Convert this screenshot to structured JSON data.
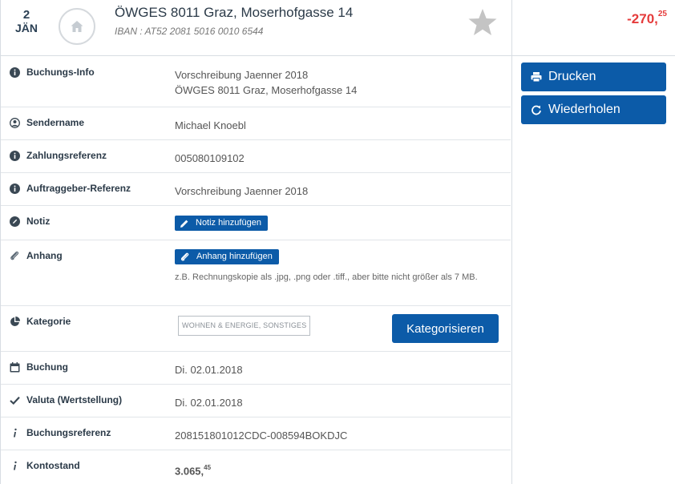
{
  "header": {
    "date_day": "2",
    "date_month": "JÄN",
    "title": "ÖWGES 8011 Graz, Moserhofgasse 14",
    "iban": "IBAN : AT52 2081 5016 0010 6544",
    "amount_main": "-270,",
    "amount_cents": "25",
    "colors": {
      "amount": "#e53b3b",
      "title": "#2b3a48"
    }
  },
  "rows": {
    "buchungsinfo": {
      "label": "Buchungs-Info",
      "line1": "Vorschreibung Jaenner 2018",
      "line2": "ÖWGES 8011 Graz, Moserhofgasse 14"
    },
    "sendername": {
      "label": "Sendername",
      "value": "Michael Knoebl"
    },
    "zahlungsreferenz": {
      "label": "Zahlungsreferenz",
      "value": "005080109102"
    },
    "auftraggeber": {
      "label": "Auftraggeber-Referenz",
      "value": "Vorschreibung Jaenner 2018"
    },
    "notiz": {
      "label": "Notiz",
      "button": "Notiz hinzufügen"
    },
    "anhang": {
      "label": "Anhang",
      "button": "Anhang hinzufügen",
      "hint": "z.B. Rechnungskopie als .jpg, .png oder .tiff., aber bitte nicht größer als 7 MB."
    },
    "kategorie": {
      "label": "Kategorie",
      "tag": "WOHNEN & ENERGIE, SONSTIGES",
      "button": "Kategorisieren"
    },
    "buchung": {
      "label": "Buchung",
      "value": "Di. 02.01.2018"
    },
    "valuta": {
      "label": "Valuta (Wertstellung)",
      "value": "Di. 02.01.2018"
    },
    "buchungsreferenz": {
      "label": "Buchungsreferenz",
      "value": "208151801012CDC-008594BOKDJC"
    },
    "kontostand": {
      "label": "Kontostand",
      "value_main": "3.065,",
      "value_cents": "45"
    }
  },
  "actions": {
    "print": "Drucken",
    "repeat": "Wiederholen"
  },
  "icons": {
    "house": "house-icon",
    "star": "star-icon",
    "info": "info-icon",
    "user": "user-icon",
    "pencil": "pencil-icon",
    "paperclip": "paperclip-icon",
    "pie": "pie-chart-icon",
    "calendar": "calendar-icon",
    "check": "check-icon",
    "italic-i": "info-i-icon",
    "printer": "printer-icon",
    "repeat": "repeat-icon"
  },
  "colors": {
    "primary": "#0c5ba8",
    "positive": "#2e9d45",
    "negative": "#e53b3b"
  }
}
